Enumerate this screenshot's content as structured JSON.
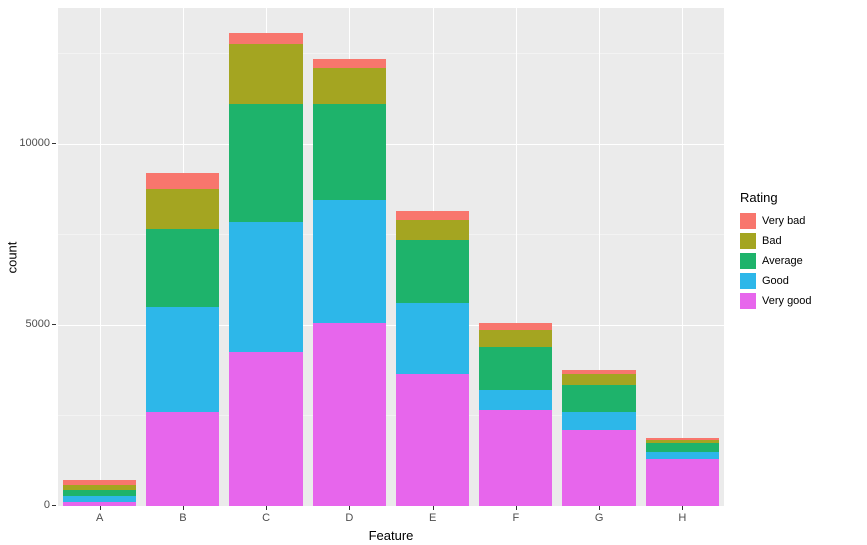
{
  "chart_data": {
    "type": "bar",
    "stacked": true,
    "categories": [
      "A",
      "B",
      "C",
      "D",
      "E",
      "F",
      "G",
      "H"
    ],
    "series": [
      {
        "name": "Very good",
        "color": "#E766EC",
        "values": [
          120,
          2600,
          4250,
          5050,
          3650,
          2650,
          2100,
          1300
        ]
      },
      {
        "name": "Good",
        "color": "#2DB7E9",
        "values": [
          160,
          2900,
          3600,
          3400,
          1950,
          550,
          500,
          200
        ]
      },
      {
        "name": "Average",
        "color": "#1EB36B",
        "values": [
          170,
          2150,
          3250,
          2650,
          1750,
          1200,
          750,
          250
        ]
      },
      {
        "name": "Bad",
        "color": "#A4A521",
        "values": [
          130,
          1100,
          1650,
          1000,
          550,
          450,
          300,
          80
        ]
      },
      {
        "name": "Very bad",
        "color": "#F8766D",
        "values": [
          150,
          450,
          300,
          250,
          250,
          200,
          100,
          50
        ]
      }
    ],
    "xlabel": "Feature",
    "ylabel": "count",
    "y_ticks": [
      0,
      5000,
      10000
    ],
    "ylim": [
      0,
      13750
    ],
    "legend_title": "Rating",
    "legend_order": [
      "Very bad",
      "Bad",
      "Average",
      "Good",
      "Very good"
    ]
  }
}
